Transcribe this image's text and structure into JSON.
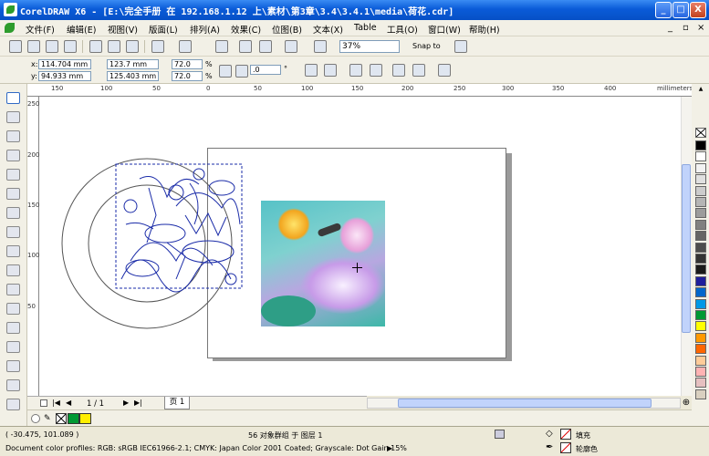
{
  "titlebar": {
    "title": "CorelDRAW X6 - [E:\\完全手册 在 192.168.1.12 上\\素材\\第3章\\3.4\\3.4.1\\media\\荷花.cdr]",
    "min": "_",
    "max": "□",
    "close": "X"
  },
  "menu": [
    "文件(F)",
    "编辑(E)",
    "视图(V)",
    "版面(L)",
    "排列(A)",
    "效果(C)",
    "位图(B)",
    "文本(X)",
    "Table",
    "工具(O)",
    "窗口(W)",
    "帮助(H)"
  ],
  "menu_right": {
    "min": "_",
    "restore": "▫",
    "close": "×"
  },
  "toolbar": {
    "zoom": "37%",
    "snap_to": "Snap to"
  },
  "propbar": {
    "x_label": "x:",
    "x_value": "114.704 mm",
    "y_label": "y:",
    "y_value": "94.933 mm",
    "w_value": "123.7 mm",
    "h_value": "125.403 mm",
    "scale_w": "72.0",
    "scale_h": "72.0",
    "pct": "%",
    "rotation": ".0",
    "deg": "°"
  },
  "rulers": {
    "h_ticks": [
      "150",
      "100",
      "50",
      "0",
      "50",
      "100",
      "150",
      "200",
      "250",
      "300",
      "350",
      "400"
    ],
    "h_unit": "millimeters",
    "v_ticks": [
      "250",
      "200",
      "150",
      "100",
      "50"
    ],
    "v_unit": "millimeters"
  },
  "pagebar": {
    "current": "1 / 1",
    "tab": "页 1"
  },
  "status": {
    "coords": "( -30.475, 101.089 )",
    "selection": "56 对象群组 于 图层 1",
    "profiles": "Document color profiles: RGB: sRGB IEC61966-2.1; CMYK: Japan Color 2001 Coated; Grayscale: Dot Gain 15%",
    "fill_label": "填充",
    "outline_label": "轮廓色"
  },
  "palette": [
    "#000000",
    "#ffffff",
    "#f2f2f2",
    "#e0e0e0",
    "#cccccc",
    "#b5b5b5",
    "#9c9c9c",
    "#808080",
    "#666666",
    "#4d4d4d",
    "#333333",
    "#1a1a1a",
    "#1e1e9c",
    "#0066cc",
    "#0099e6",
    "#009933",
    "#ffff00",
    "#ff9900",
    "#ff6600",
    "#ffcc99",
    "#ffb3b3",
    "#e6c0c0",
    "#d9d0c0"
  ],
  "colors": {
    "accent": "#0a5bd8",
    "outline_blue": "#1a2ba8",
    "fill_green": "#009933",
    "fill_yellow": "#ffee00"
  }
}
